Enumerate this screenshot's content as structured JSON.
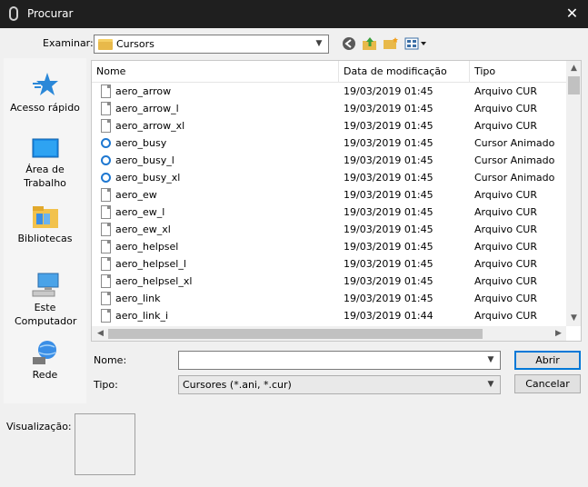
{
  "window": {
    "title": "Procurar",
    "close_glyph": "✕"
  },
  "look_in": {
    "label": "Examinar:",
    "value": "Cursors"
  },
  "toolbar": {
    "icons": [
      "back-icon",
      "up-folder-icon",
      "new-folder-icon",
      "view-menu-icon"
    ]
  },
  "places": [
    {
      "id": "quick-access",
      "label": "Acesso rápido",
      "icon": "star-icon"
    },
    {
      "id": "desktop",
      "label": "Área de Trabalho",
      "icon": "desktop-icon"
    },
    {
      "id": "libraries",
      "label": "Bibliotecas",
      "icon": "libraries-icon"
    },
    {
      "id": "this-pc",
      "label": "Este Computador",
      "icon": "computer-icon"
    },
    {
      "id": "network",
      "label": "Rede",
      "icon": "network-icon"
    }
  ],
  "columns": {
    "name": "Nome",
    "date": "Data de modificação",
    "type": "Tipo"
  },
  "files": [
    {
      "name": "aero_arrow",
      "date": "19/03/2019 01:45",
      "type": "Arquivo CUR",
      "icon": "file-icon"
    },
    {
      "name": "aero_arrow_l",
      "date": "19/03/2019 01:45",
      "type": "Arquivo CUR",
      "icon": "file-icon"
    },
    {
      "name": "aero_arrow_xl",
      "date": "19/03/2019 01:45",
      "type": "Arquivo CUR",
      "icon": "file-icon"
    },
    {
      "name": "aero_busy",
      "date": "19/03/2019 01:45",
      "type": "Cursor Animado",
      "icon": "busy-cursor-icon"
    },
    {
      "name": "aero_busy_l",
      "date": "19/03/2019 01:45",
      "type": "Cursor Animado",
      "icon": "busy-cursor-icon"
    },
    {
      "name": "aero_busy_xl",
      "date": "19/03/2019 01:45",
      "type": "Cursor Animado",
      "icon": "busy-cursor-icon"
    },
    {
      "name": "aero_ew",
      "date": "19/03/2019 01:45",
      "type": "Arquivo CUR",
      "icon": "file-icon"
    },
    {
      "name": "aero_ew_l",
      "date": "19/03/2019 01:45",
      "type": "Arquivo CUR",
      "icon": "file-icon"
    },
    {
      "name": "aero_ew_xl",
      "date": "19/03/2019 01:45",
      "type": "Arquivo CUR",
      "icon": "file-icon"
    },
    {
      "name": "aero_helpsel",
      "date": "19/03/2019 01:45",
      "type": "Arquivo CUR",
      "icon": "file-icon"
    },
    {
      "name": "aero_helpsel_l",
      "date": "19/03/2019 01:45",
      "type": "Arquivo CUR",
      "icon": "file-icon"
    },
    {
      "name": "aero_helpsel_xl",
      "date": "19/03/2019 01:45",
      "type": "Arquivo CUR",
      "icon": "file-icon"
    },
    {
      "name": "aero_link",
      "date": "19/03/2019 01:45",
      "type": "Arquivo CUR",
      "icon": "file-icon"
    },
    {
      "name": "aero_link_i",
      "date": "19/03/2019 01:44",
      "type": "Arquivo CUR",
      "icon": "file-icon"
    }
  ],
  "filename": {
    "label": "Nome:",
    "value": ""
  },
  "filetype": {
    "label": "Tipo:",
    "value": "Cursores (*.ani, *.cur)"
  },
  "buttons": {
    "open": "Abrir",
    "cancel": "Cancelar"
  },
  "preview": {
    "label": "Visualização:"
  },
  "colors": {
    "titlebar": "#1f1f1f",
    "accent": "#0078d7",
    "busy_ring": "#1f78d1"
  }
}
